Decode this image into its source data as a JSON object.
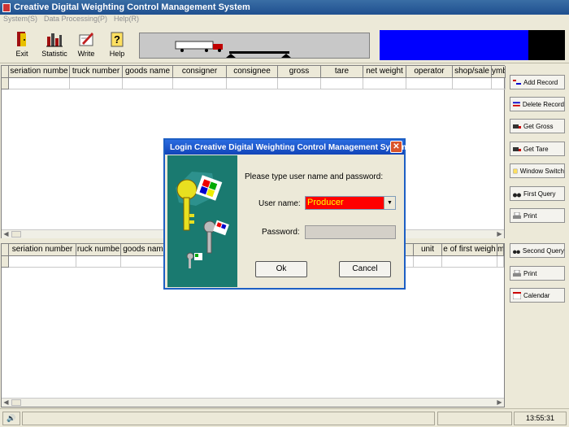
{
  "window": {
    "title": "Creative Digital Weighting Control Management System"
  },
  "menu": [
    "System(S)",
    "Data Processing(P)",
    "Help(R)"
  ],
  "toolbar": [
    {
      "label": "Exit",
      "icon": "exit-icon"
    },
    {
      "label": "Statistic",
      "icon": "statistic-icon"
    },
    {
      "label": "Write",
      "icon": "write-icon"
    },
    {
      "label": "Help",
      "icon": "help-icon"
    }
  ],
  "top_grid": {
    "columns": [
      "seriation numbe",
      "truck number",
      "goods name",
      "consigner",
      "consignee",
      "gross",
      "tare",
      "net weight",
      "operator",
      "shop/sale",
      "ymbo"
    ]
  },
  "bottom_grid": {
    "columns": [
      "seriation number",
      "ruck numbe",
      "goods nam",
      "",
      "",
      "",
      "",
      "nt",
      "unit",
      "e of first weigh",
      "m"
    ]
  },
  "side_buttons": {
    "add_record": "Add Record",
    "delete_record": "Delete Record",
    "get_gross": "Get Gross",
    "get_tare": "Get Tare",
    "window_switch": "Window Switch",
    "first_query": "First Query",
    "print1": "Print",
    "second_query": "Second Query",
    "print2": "Print",
    "calendar": "Calendar"
  },
  "dialog": {
    "title": "Login Creative Digital Weighting Control Management System",
    "prompt": "Please type user name and password:",
    "user_label": "User name:",
    "user_value": "Producer",
    "password_label": "Password:",
    "ok": "Ok",
    "cancel": "Cancel"
  },
  "status": {
    "time": "13:55:31"
  },
  "colors": {
    "accent_blue": "#0000ff",
    "user_field_bg": "#ff0000",
    "user_field_text": "#ffff00"
  }
}
